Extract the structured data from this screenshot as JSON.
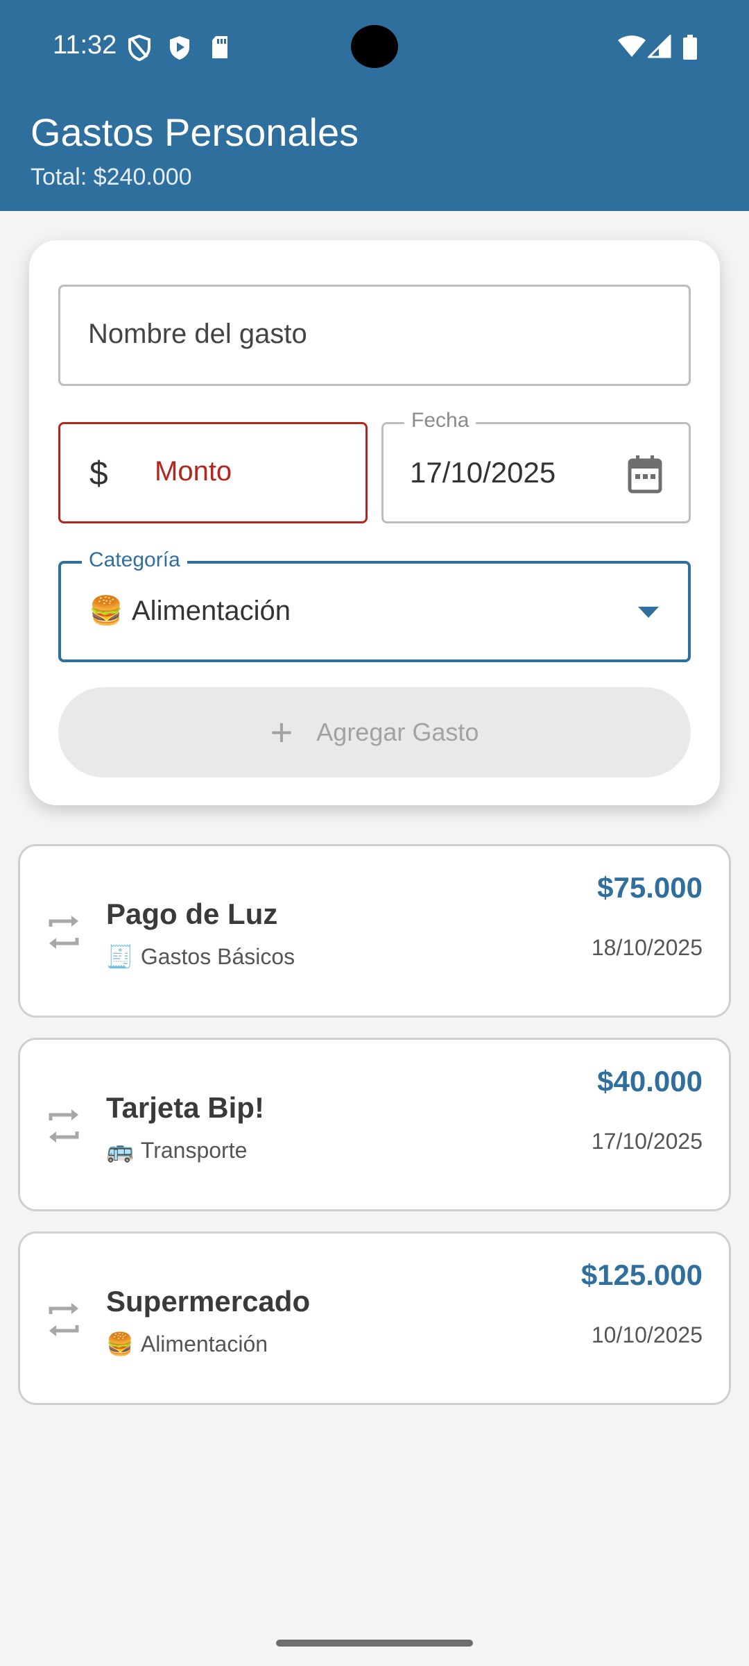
{
  "status_bar": {
    "time": "11:32",
    "icons": [
      "shield-outline-icon",
      "shield-play-icon",
      "sd-card-icon",
      "wifi-icon",
      "signal-icon",
      "battery-icon"
    ]
  },
  "header": {
    "title": "Gastos Personales",
    "total": "Total: $240.000",
    "color": "#2e6f9e"
  },
  "form": {
    "name_placeholder": "Nombre del gasto",
    "amount_prefix": "$",
    "amount_placeholder": "Monto",
    "amount_error_color": "#b3261e",
    "date_label": "Fecha",
    "date_value": "17/10/2025",
    "category_label": "Categoría",
    "category_emoji": "🍔",
    "category_value": "Alimentación",
    "add_label": "Agregar Gasto"
  },
  "expenses": [
    {
      "name": "Pago de Luz",
      "emoji": "🧾",
      "category": "Gastos Básicos",
      "amount": "$75.000",
      "date": "18/10/2025"
    },
    {
      "name": "Tarjeta Bip!",
      "emoji": "🚌",
      "category": "Transporte",
      "amount": "$40.000",
      "date": "17/10/2025"
    },
    {
      "name": "Supermercado",
      "emoji": "🍔",
      "category": "Alimentación",
      "amount": "$125.000",
      "date": "10/10/2025"
    }
  ]
}
